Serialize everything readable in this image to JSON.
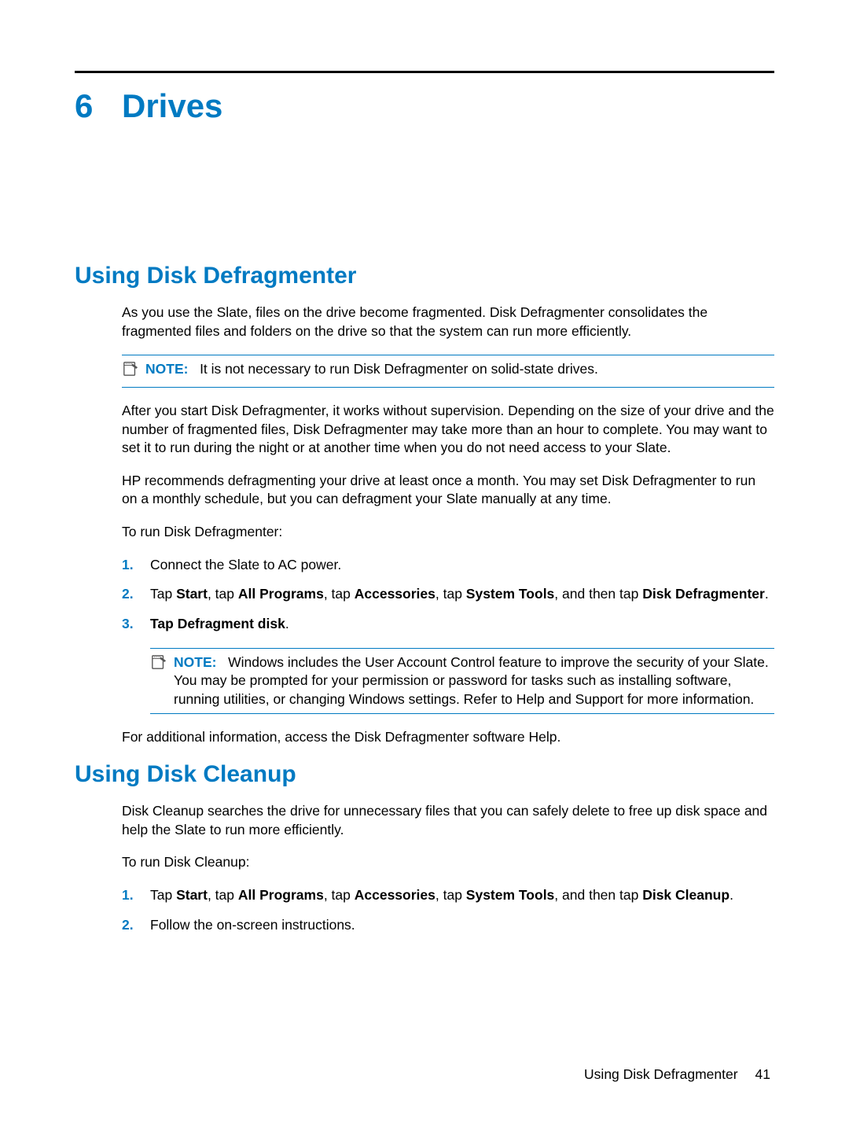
{
  "chapter": {
    "number": "6",
    "title": "Drives"
  },
  "section1": {
    "title": "Using Disk Defragmenter",
    "para1": "As you use the Slate, files on the drive become fragmented. Disk Defragmenter consolidates the fragmented files and folders on the drive so that the system can run more efficiently.",
    "note1_label": "NOTE:",
    "note1_text": "It is not necessary to run Disk Defragmenter on solid-state drives.",
    "para2": "After you start Disk Defragmenter, it works without supervision. Depending on the size of your drive and the number of fragmented files, Disk Defragmenter may take more than an hour to complete. You may want to set it to run during the night or at another time when you do not need access to your Slate.",
    "para3": "HP recommends defragmenting your drive at least once a month. You may set Disk Defragmenter to run on a monthly schedule, but you can defragment your Slate manually at any time.",
    "para4": "To run Disk Defragmenter:",
    "step1": "Connect the Slate to AC power.",
    "step2_pre": "Tap ",
    "step2_b1": "Start",
    "step2_t1": ", tap ",
    "step2_b2": "All Programs",
    "step2_t2": ", tap ",
    "step2_b3": "Accessories",
    "step2_t3": ", tap ",
    "step2_b4": "System Tools",
    "step2_t4": ", and then tap ",
    "step2_b5": "Disk Defragmenter",
    "step2_t5": ".",
    "step3_pre": "Tap ",
    "step3_b1": "Defragment disk",
    "step3_t1": ".",
    "note2_label": "NOTE:",
    "note2_text": "Windows includes the User Account Control feature to improve the security of your Slate. You may be prompted for your permission or password for tasks such as installing software, running utilities, or changing Windows settings. Refer to Help and Support for more information.",
    "para5": "For additional information, access the Disk Defragmenter software Help."
  },
  "section2": {
    "title": "Using Disk Cleanup",
    "para1": "Disk Cleanup searches the drive for unnecessary files that you can safely delete to free up disk space and help the Slate to run more efficiently.",
    "para2": "To run Disk Cleanup:",
    "step1_pre": "Tap ",
    "step1_b1": "Start",
    "step1_t1": ", tap ",
    "step1_b2": "All Programs",
    "step1_t2": ", tap ",
    "step1_b3": "Accessories",
    "step1_t3": ", tap ",
    "step1_b4": "System Tools",
    "step1_t4": ", and then tap ",
    "step1_b5": "Disk Cleanup",
    "step1_t5": ".",
    "step2": "Follow the on-screen instructions."
  },
  "footer": {
    "title": "Using Disk Defragmenter",
    "page": "41"
  }
}
